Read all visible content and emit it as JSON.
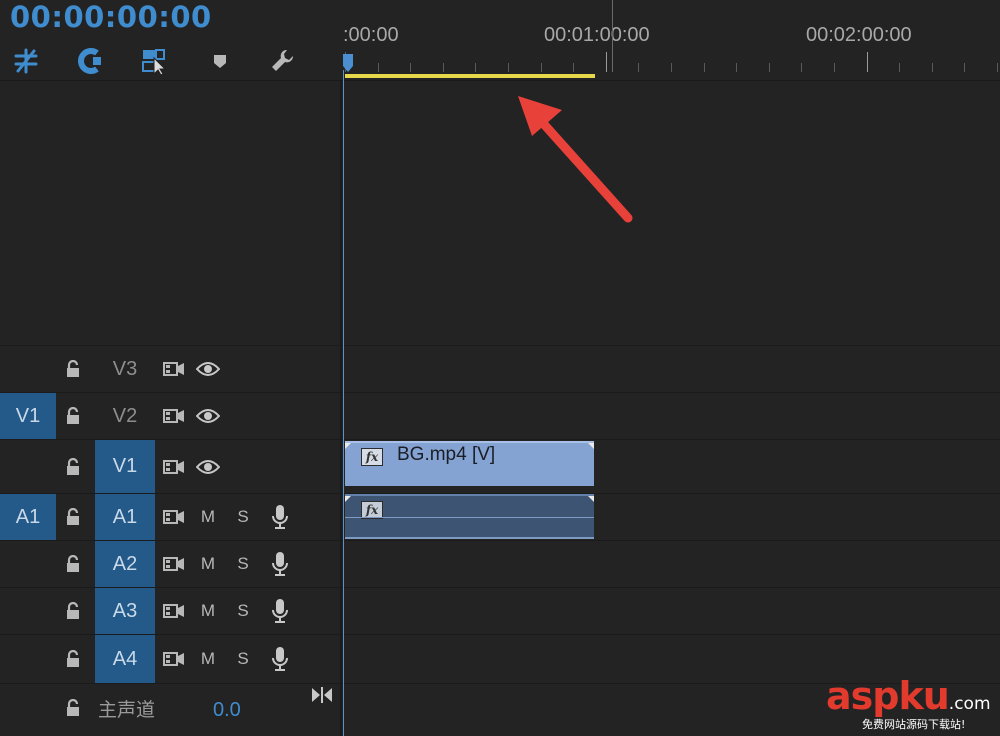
{
  "header": {
    "timecode": "00:00:00:00",
    "tools": [
      {
        "icon": "ripple-nest-icon",
        "color": "#3f8ccf"
      },
      {
        "icon": "snap-magnet-icon",
        "color": "#3f8ccf"
      },
      {
        "icon": "linked-selection-icon",
        "color": "#3f8ccf"
      },
      {
        "icon": "add-marker-icon",
        "color": "#b8b8b8"
      },
      {
        "icon": "settings-wrench-icon",
        "color": "#b8b8b8"
      }
    ]
  },
  "ruler": {
    "labels": [
      ":00:00",
      "00:01:00:00",
      "00:02:00:00"
    ]
  },
  "tracks": {
    "video": [
      {
        "source_patch": "",
        "target": "V3",
        "source_active": false,
        "target_active": false
      },
      {
        "source_patch": "V1",
        "target": "V2",
        "source_active": true,
        "target_active": false
      },
      {
        "source_patch": "",
        "target": "V1",
        "source_active": false,
        "target_active": true
      }
    ],
    "audio": [
      {
        "source_patch": "A1",
        "target": "A1",
        "mute": "M",
        "solo": "S",
        "source_active": true,
        "target_active": true
      },
      {
        "source_patch": "",
        "target": "A2",
        "mute": "M",
        "solo": "S",
        "source_active": false,
        "target_active": true
      },
      {
        "source_patch": "",
        "target": "A3",
        "mute": "M",
        "solo": "S",
        "source_active": false,
        "target_active": true
      },
      {
        "source_patch": "",
        "target": "A4",
        "mute": "M",
        "solo": "S",
        "source_active": false,
        "target_active": true
      }
    ]
  },
  "clips": {
    "video_clip_name": "BG.mp4 [V]",
    "fx_label": "fx"
  },
  "master": {
    "label": "主声道",
    "value": "0.0"
  },
  "watermark": {
    "brand": "aspku",
    "suffix": ".com",
    "sub": "免费网站源码下载站!"
  },
  "colors": {
    "accent": "#3f8ccf",
    "work_area": "#e6d84a",
    "video_clip": "#84a3d3",
    "audio_clip": "#3d5573",
    "active_patch": "#235a8a",
    "annotation": "#e8413a"
  }
}
